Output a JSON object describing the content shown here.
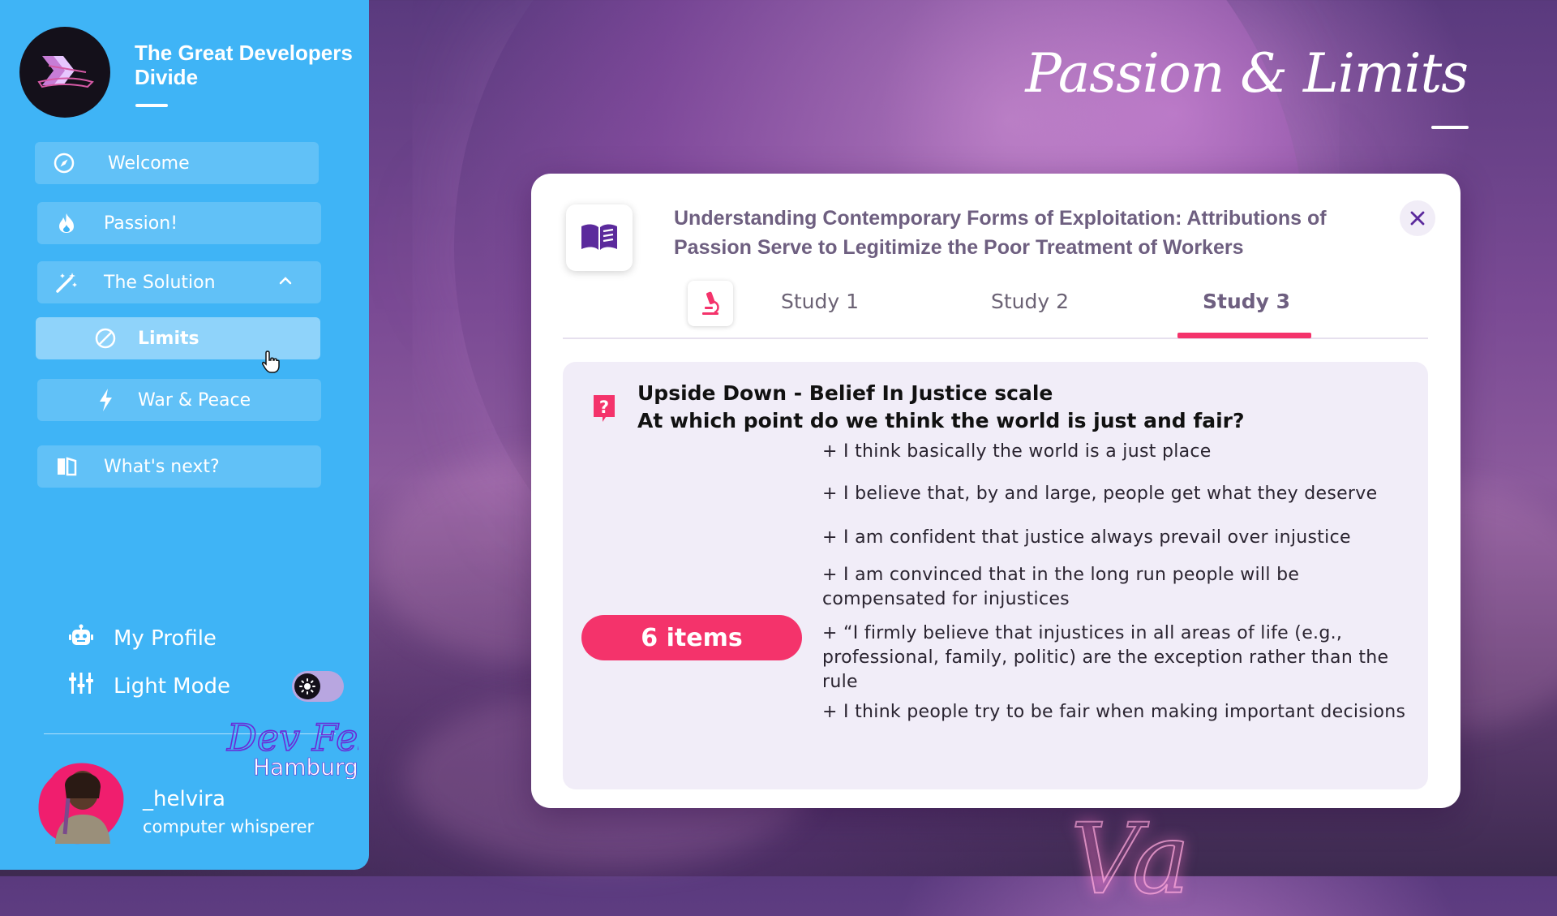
{
  "sidebar": {
    "brand_title": "The Great Developers Divide",
    "nav": {
      "welcome": "Welcome",
      "passion": "Passion!",
      "solution": "The Solution",
      "limits": "Limits",
      "war_peace": "War & Peace",
      "whats_next": "What's next?"
    },
    "profile_label": "My Profile",
    "light_mode_label": "Light Mode",
    "logo_text": "DevFest Hamburg",
    "user": {
      "name": "_helvira",
      "role": "computer whisperer"
    }
  },
  "page": {
    "title": "Passion & Limits"
  },
  "modal": {
    "paper_title": "Understanding Contemporary Forms of Exploitation: Attributions of Passion Serve to Legitimize the Poor Treatment of Workers",
    "tabs": [
      "Study 1",
      "Study 2",
      "Study 3"
    ],
    "active_tab": "Study 3",
    "question_line1": "Upside Down - Belief In Justice scale",
    "question_line2": "At which point do we think the world is just and fair?",
    "items_badge": "6 items",
    "statements": [
      "+ I think basically the world is a just place",
      "+ I believe that, by and large, people get what they deserve",
      "+ I am confident that justice always prevail over injustice",
      "+ I am convinced that in the long run people will be compensated for injustices",
      "+ “I firmly believe that injustices in all areas of life (e.g., professional, family, politic) are the exception rather than the rule",
      "+ I think people try to be fair when making important decisions"
    ]
  },
  "colors": {
    "sidebar": "#3fb4f6",
    "accent": "#f4336b",
    "purple": "#5b2a9c",
    "title_text": "#6e5f80"
  }
}
